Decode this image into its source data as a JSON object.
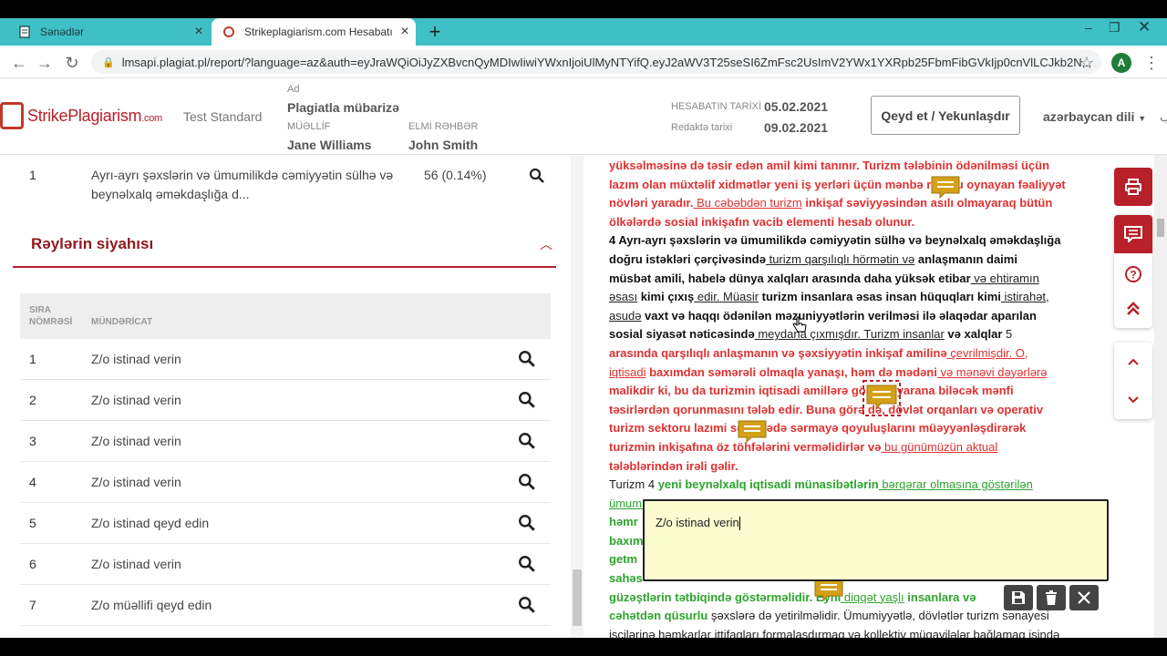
{
  "browser": {
    "tabs": [
      {
        "label": "Sənədlər",
        "active": false
      },
      {
        "label": "Strikeplagiarism.com Hesabatı",
        "active": true
      }
    ],
    "url": "lmsapi.plagiat.pl/report/?language=az&auth=eyJraWQiOiJyZXBvcnQyMDIwIiwiYWxnIjoiUlMyNTYifQ.eyJ2aWV3T25seSI6ZmFsc2UsImV2YWx1YXRpb25FbmFibGVkIjp0cnVlLCJkb2N...",
    "avatar_letter": "A",
    "accent": "#3fbfc6"
  },
  "header": {
    "brand_main": "StrikePlagiarism",
    "brand_suffix": ".com",
    "test_label": "Test Standard",
    "ad_label": "Ad",
    "ad_value": "Plagiatla mübarizə",
    "author_label": "MÜƏLLİF",
    "author_value": "Jane Williams",
    "advisor_label": "ELMİ RƏHBƏR",
    "advisor_value": "John Smith",
    "report_date_label": "HESABATIN TARİXİ",
    "report_date_value": "05.02.2021",
    "edit_date_label": "Redaktə tarixi",
    "edit_date_value": "09.02.2021",
    "action_button": "Qeyd et / Yekunlaşdır",
    "language": "azərbaycan dili",
    "brand_color": "#b8202a"
  },
  "left": {
    "top_item": {
      "num": "1",
      "text_line1": "Ayrı-ayrı şəxslərin və ümumilikdə cəmiyyətin sülhə və",
      "text_line2": "beynəlxalq əməkdaşlığa d...",
      "count": "56 (0.14%)"
    },
    "section_title": "Rəylərin siyahısı",
    "table": {
      "col_num_line1": "SIRA",
      "col_num_line2": "NÖMRƏSİ",
      "col_content": "MÜNDƏRİCAT",
      "rows": [
        {
          "num": "1",
          "content": "Z/o istinad verin"
        },
        {
          "num": "2",
          "content": "Z/o istinad verin"
        },
        {
          "num": "3",
          "content": "Z/o istinad verin"
        },
        {
          "num": "4",
          "content": "Z/o istinad verin"
        },
        {
          "num": "5",
          "content": "Z/o istinad qeyd edin"
        },
        {
          "num": "6",
          "content": "Z/o istinad verin"
        },
        {
          "num": "7",
          "content": "Z/o müəllifi qeyd edin"
        }
      ]
    }
  },
  "doc": {
    "l1": "yüksəlməsinə də təsir edən amil kimi tanınır. Turizm tələbinin ödənilməsi üçün",
    "l2": "lazım olan müxtəlif xidmətlər yeni iş yerləri üçün mənbə rolunu oynayan fəaliyyət",
    "l3a": "növləri yaradır.",
    "l3b": " Bu   cəbəbdən  turizm",
    "l3c": " inkişaf səviyyəsindən asılı olmayaraq bütün",
    "l4": "ölkələrdə sosial inkişafın vacib elementi hesab olunur.",
    "l5": "4  Ayrı-ayrı şəxslərin və ümumilikdə cəmiyyətin sülhə və beynəlxalq əməkdaşlığa",
    "l6a": "doğru istəkləri çərçivəsində",
    "l6b": " turizm  qarşılıqlı hörmətin  və",
    "l6c": " anlaşmanın daimi",
    "l7a": "müsbət amili, habelə dünya xalqları arasında daha yüksək etibar",
    "l7b": "  və  ehtiramın",
    "l8a": "əsası",
    "l8b": " kimi çıxış",
    "l8c": "  edir.   Müasir",
    "l8d": " turizm insanlara əsas insan hüquqları kimi",
    "l8e": "  istirahət,",
    "l9a": "asudə",
    "l9b": " vaxt və haqqı ödənilən məzuniyyətlərin verilməsi ilə əlaqədar aparılan",
    "l10a": "sosial siyasət nəticəsində",
    "l10b": "  meydana  çıxmışdır. Turizm  insanlar",
    "l10c": " və xalqlar",
    "l10d": "  5",
    "l11a": "arasında qarşılıqlı anlaşmanın və şəxsiyyətin inkişaf amilinə",
    "l11b": "  çevrilmişdir.   O,",
    "l12a": "iqtisadi",
    "l12b": " baxımdan səmərəli olmaqla yanaşı, həm də mədəni",
    "l12c": "  və   mənəvi  dəyərlərə",
    "l13": "malikdir ki, bu da turizmin iqtisadi amillərə görə ilə yarana biləcək mənfi",
    "l14": "təsirlərdən qorunmasını tələb edir. Buna görə də, dövlət orqanları və operativ",
    "l15": "turizm sektoru lazımi səviyyədə sərmayə qoyuluşlarını müəyyənləşdirərək",
    "l16a": "turizmin inkişafına öz töhfələrini verməlidirlər və",
    "l16b": "  bu   günümüzün  aktual",
    "l17": "tələblərindən irəli gəlir.",
    "l18a": "Turizm 4",
    "l18b": "  yeni beynəlxalq iqtisadi münasibətlərin",
    "l18c": "  bərqərar  olmasına göstərilən",
    "l19": "ümumi",
    "l20": "həmr",
    "l21": "baxım",
    "l22": "getm",
    "l23": "sahəs",
    "l24a": "güzəştlərin tətbiqində göstərməlidir. Eyni",
    "l24b": "  diqqət   yaşlı",
    "l24c": " insanlara və",
    "l25a": "cəhətdən qüsurlu",
    "l25b": "   şəxslərə də yetirilməlidir. Ümumiyyətlə, dövlətlər turizm sənayesi",
    "l26": "işçilərinə həmkarlar ittifaqları formalaşdırmaq və kollektiv müqavilələr bağlamaq işində"
  },
  "comment": {
    "text": "Z/o istinad verin",
    "note_color": "#fdfbd0",
    "marker_color": "#d4a017"
  }
}
